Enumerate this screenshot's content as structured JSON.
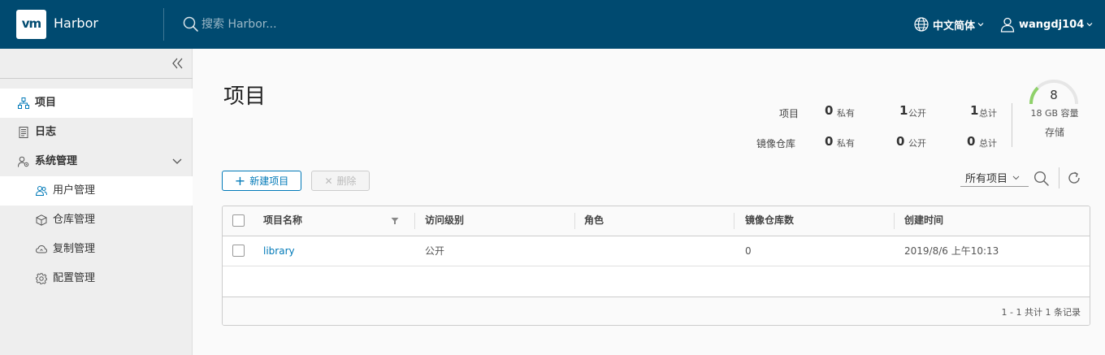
{
  "header": {
    "logo_text": "vm",
    "app_name": "Harbor",
    "search_placeholder": "搜索 Harbor...",
    "language": "中文简体",
    "username": "wangdj104",
    "bg_color": "#004a70"
  },
  "sidebar": {
    "collapse_icon": "double-chevron-left-icon",
    "items": [
      {
        "label": "项目",
        "icon": "project-tree-icon",
        "active": true
      },
      {
        "label": "日志",
        "icon": "log-document-icon",
        "active": false
      },
      {
        "label": "系统管理",
        "icon": "admin-user-gear-icon",
        "expanded": true
      },
      {
        "label": "用户管理",
        "icon": "users-icon",
        "active": false,
        "sub": true
      },
      {
        "label": "仓库管理",
        "icon": "cube-icon",
        "active": false,
        "sub": true
      },
      {
        "label": "复制管理",
        "icon": "cloud-sync-icon",
        "active": false,
        "sub": true
      },
      {
        "label": "配置管理",
        "icon": "gear-icon",
        "active": false,
        "sub": true
      }
    ]
  },
  "main": {
    "title": "项目",
    "stats": {
      "projects_label": "项目",
      "repos_label": "镜像仓库",
      "private_label": "私有",
      "public_label": "公开",
      "total_label": "总计",
      "projects": {
        "private": "0",
        "public": "1",
        "total": "1"
      },
      "repos": {
        "private": "0",
        "public": "0",
        "total": "0"
      }
    },
    "storage": {
      "count": "8",
      "capacity_text": "18 GB 容量",
      "label": "存储",
      "used_fraction": 0.25,
      "accent": "#8fd16a"
    },
    "toolbar": {
      "new_label": "新建项目",
      "delete_label": "删除",
      "filter_label": "所有项目"
    },
    "table": {
      "columns": [
        "项目名称",
        "访问级别",
        "角色",
        "镜像仓库数",
        "创建时间"
      ],
      "rows": [
        {
          "name": "library",
          "access": "公开",
          "role": "",
          "repo_count": "0",
          "created": "2019/8/6 上午10:13"
        }
      ],
      "footer": "1 - 1 共计 1 条记录"
    }
  }
}
